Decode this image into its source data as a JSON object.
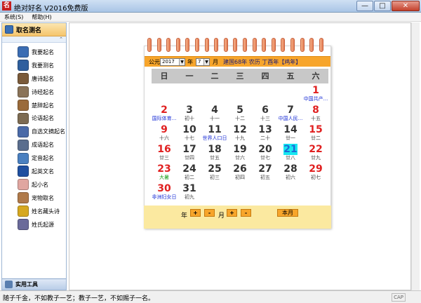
{
  "window": {
    "title": "绝对好名 V2016免费版",
    "app_icon_text": "名",
    "minimize": "—",
    "maximize": "□",
    "close": "✕"
  },
  "menu": [
    {
      "label": "系统(S)"
    },
    {
      "label": "帮助(H)"
    }
  ],
  "sidebar": {
    "header": "取名测名",
    "items": [
      {
        "label": "我要起名",
        "color": "#3b6db3"
      },
      {
        "label": "我要测名",
        "color": "#2f5f9e"
      },
      {
        "label": "唐诗起名",
        "color": "#7a5a3a"
      },
      {
        "label": "诗经起名",
        "color": "#8a7358"
      },
      {
        "label": "楚辞起名",
        "color": "#9a6a3a"
      },
      {
        "label": "论语起名",
        "color": "#7d6b52"
      },
      {
        "label": "自选文摘起名",
        "color": "#4a6aa8"
      },
      {
        "label": "成语起名",
        "color": "#5a6e8e"
      },
      {
        "label": "定音起名",
        "color": "#4a80c0"
      },
      {
        "label": "起英文名",
        "color": "#1f4fa0"
      },
      {
        "label": "起小名",
        "color": "#e0a6a0"
      },
      {
        "label": "宠物取名",
        "color": "#b07a4a"
      },
      {
        "label": "姓名藏头诗",
        "color": "#d6a820"
      },
      {
        "label": "姓氏起源",
        "color": "#6a6a9a"
      }
    ],
    "footer": "实用工具"
  },
  "calendar": {
    "year_prefix": "公元",
    "year_value": "2017",
    "year_label": "年",
    "month_value": "7",
    "month_label": "月",
    "lunar_info": "建国68年 农历 丁酉年【鸡年】",
    "weekdays": [
      "日",
      "一",
      "二",
      "三",
      "四",
      "五",
      "六"
    ],
    "days": [
      {
        "d": "1",
        "s": "中国共产...",
        "c": "red",
        "st": "hol"
      },
      {
        "d": "2",
        "s": "国际体育...",
        "c": "red",
        "st": "hol"
      },
      {
        "d": "3",
        "s": "初十",
        "c": "dark",
        "st": "norm"
      },
      {
        "d": "4",
        "s": "十一",
        "c": "dark",
        "st": "norm"
      },
      {
        "d": "5",
        "s": "十二",
        "c": "dark",
        "st": "norm"
      },
      {
        "d": "6",
        "s": "十三",
        "c": "dark",
        "st": "norm"
      },
      {
        "d": "7",
        "s": "中国人民...",
        "c": "dark",
        "st": "hol"
      },
      {
        "d": "8",
        "s": "十五",
        "c": "red",
        "st": "norm"
      },
      {
        "d": "9",
        "s": "十六",
        "c": "red",
        "st": "norm"
      },
      {
        "d": "10",
        "s": "十七",
        "c": "dark",
        "st": "norm"
      },
      {
        "d": "11",
        "s": "世界人口日",
        "c": "dark",
        "st": "hol"
      },
      {
        "d": "12",
        "s": "十九",
        "c": "dark",
        "st": "norm"
      },
      {
        "d": "13",
        "s": "二十",
        "c": "dark",
        "st": "norm"
      },
      {
        "d": "14",
        "s": "廿一",
        "c": "dark",
        "st": "norm"
      },
      {
        "d": "15",
        "s": "廿二",
        "c": "red",
        "st": "norm"
      },
      {
        "d": "16",
        "s": "廿三",
        "c": "red",
        "st": "norm"
      },
      {
        "d": "17",
        "s": "廿四",
        "c": "dark",
        "st": "norm"
      },
      {
        "d": "18",
        "s": "廿五",
        "c": "dark",
        "st": "norm"
      },
      {
        "d": "19",
        "s": "廿六",
        "c": "dark",
        "st": "norm"
      },
      {
        "d": "20",
        "s": "廿七",
        "c": "dark",
        "st": "norm"
      },
      {
        "d": "21",
        "s": "廿八",
        "c": "dark",
        "st": "norm",
        "today": true
      },
      {
        "d": "22",
        "s": "廿九",
        "c": "red",
        "st": "norm"
      },
      {
        "d": "23",
        "s": "大暑",
        "c": "red",
        "st": "term"
      },
      {
        "d": "24",
        "s": "初二",
        "c": "dark",
        "st": "norm"
      },
      {
        "d": "25",
        "s": "初三",
        "c": "dark",
        "st": "norm"
      },
      {
        "d": "26",
        "s": "初四",
        "c": "dark",
        "st": "norm"
      },
      {
        "d": "27",
        "s": "初五",
        "c": "dark",
        "st": "norm"
      },
      {
        "d": "28",
        "s": "初六",
        "c": "dark",
        "st": "norm"
      },
      {
        "d": "29",
        "s": "初七",
        "c": "red",
        "st": "norm"
      },
      {
        "d": "30",
        "s": "非洲妇女日",
        "c": "red",
        "st": "hol"
      },
      {
        "d": "31",
        "s": "初九",
        "c": "dark",
        "st": "norm"
      }
    ],
    "nav": {
      "year_label": "年",
      "month_label": "月",
      "plus": "+",
      "minus": "-",
      "this_month": "本月"
    }
  },
  "status": {
    "text": "随子千金，不如教子一艺；教子一艺，不如赐子一名。",
    "cap": "CAP"
  },
  "colors": {
    "accent": "#f7a52b",
    "today": "#17e8f0",
    "red": "#e02020",
    "holiday": "#1a2ed6"
  }
}
